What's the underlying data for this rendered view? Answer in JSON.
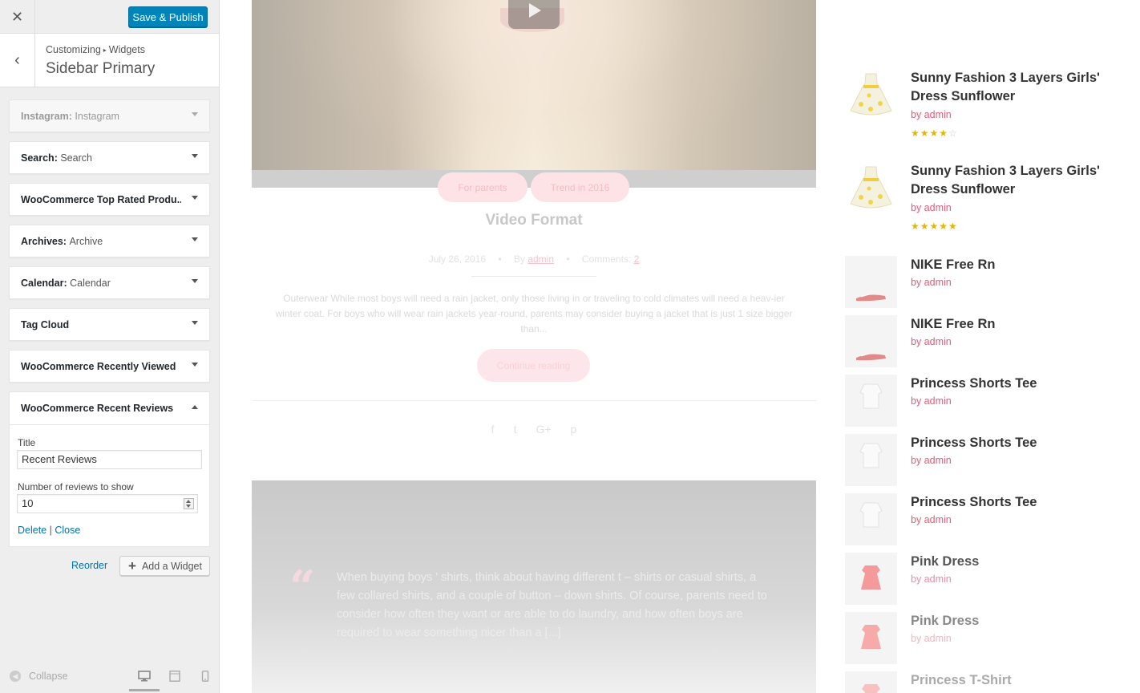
{
  "customizer": {
    "close_icon": "close-icon",
    "publish_label": "Save & Publish",
    "breadcrumb": [
      "Customizing",
      "Widgets"
    ],
    "section_title": "Sidebar Primary",
    "widgets": [
      {
        "title": "Instagram:",
        "subtitle": "Instagram"
      },
      {
        "title": "Search:",
        "subtitle": "Search"
      },
      {
        "title": "WooCommerce Top Rated Produ...",
        "subtitle": ""
      },
      {
        "title": "Archives:",
        "subtitle": "Archive"
      },
      {
        "title": "Calendar:",
        "subtitle": "Calendar"
      },
      {
        "title": "Tag Cloud",
        "subtitle": ""
      },
      {
        "title": "WooCommerce Recently Viewed",
        "subtitle": ""
      }
    ],
    "open_widget": {
      "title": "WooCommerce Recent Reviews",
      "title_label": "Title",
      "title_value": "Recent Reviews",
      "number_label": "Number of reviews to show",
      "number_value": "10",
      "delete_label": "Delete",
      "separator": "|",
      "close_label": "Close"
    },
    "reorder_label": "Reorder",
    "add_widget_label": "Add a Widget",
    "collapse_label": "Collapse"
  },
  "preview": {
    "categories": [
      "For parents",
      "Trend in 2016"
    ],
    "post_title": "Video Format",
    "post_date": "July 26, 2016",
    "post_by": "By",
    "post_author": "admin",
    "post_comments_label": "Comments:",
    "post_comments_count": "2",
    "post_excerpt": "Outerwear While most boys will need a rain jacket, only those living in or traveling to cold climates will need a heav-ier winter coat. For boys who will wear rain jackets year-round, parents may consider buying a jacket that is just 1 size bigger than...",
    "continue_label": "Continue reading",
    "share_icons": [
      "f",
      "t",
      "G+",
      "p"
    ],
    "quote_mark": "“",
    "quote_text": "When buying boys ' shirts, think about having different t – shirts or casual shirts, a few collared shirts, and a couple of button – down shirts. Of course, parents need to consider how often they want or are able to do laundry, and how often boys are required to wear something nicer than a [...]"
  },
  "products": [
    {
      "name": "Sunny Fashion 3 Layers Girls' Dress Sunflower",
      "by": "by admin",
      "rating": 4,
      "thumb": "dress-yellow"
    },
    {
      "name": "Sunny Fashion 3 Layers Girls' Dress Sunflower",
      "by": "by admin",
      "rating": 5,
      "thumb": "dress-yellow"
    },
    {
      "name": "NIKE Free Rn",
      "by": "by admin",
      "rating": 0,
      "thumb": "shoe"
    },
    {
      "name": "NIKE Free Rn",
      "by": "by admin",
      "rating": 0,
      "thumb": "shoe"
    },
    {
      "name": "Princess Shorts Tee",
      "by": "by admin",
      "rating": 0,
      "thumb": "tee"
    },
    {
      "name": "Princess Shorts Tee",
      "by": "by admin",
      "rating": 0,
      "thumb": "tee"
    },
    {
      "name": "Princess Shorts Tee",
      "by": "by admin",
      "rating": 0,
      "thumb": "tee"
    },
    {
      "name": "Pink Dress",
      "by": "by admin",
      "rating": 0,
      "thumb": "pink-dress"
    },
    {
      "name": "Pink Dress",
      "by": "by admin",
      "rating": 0,
      "thumb": "pink-dress"
    },
    {
      "name": "Princess T-Shirt",
      "by": "",
      "rating": 0,
      "thumb": "pink-dress"
    }
  ],
  "colors": {
    "accent": "#0085ba",
    "link": "#0073aa",
    "pink": "#e85a78",
    "star": "#e5b600"
  }
}
